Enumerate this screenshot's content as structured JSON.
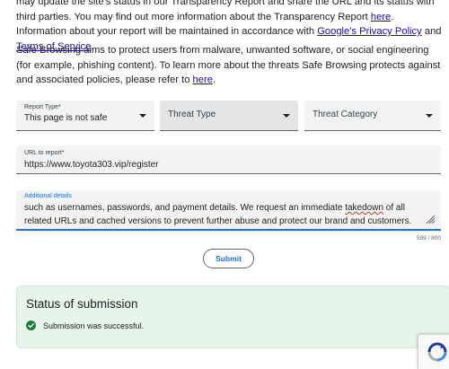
{
  "intro": {
    "p1_prefix": "may update the site's status in our Transparency Report and share the URL and its status with third parties. You may find out more information about the Transparency Report ",
    "p1_link1": "here",
    "p1_mid": ". Information about your report will be maintained in accordance with ",
    "p1_link2": "Google's Privacy Policy",
    "p1_and": " and ",
    "p1_link3": "Terms of Service",
    "p1_end": ".",
    "p2_prefix": "Safe Browsing aims to protect users from malware, unwanted software, or social engineering (for example, phishing content). To learn more about the threats Safe Browsing protects against and associated policies, please refer to ",
    "p2_link": "here",
    "p2_end": "."
  },
  "form": {
    "report_type": {
      "label": "Report Type*",
      "value": "This page is not safe"
    },
    "threat_type": {
      "placeholder": "Threat Type"
    },
    "threat_category": {
      "placeholder": "Threat Category"
    },
    "url": {
      "label": "URL to report*",
      "value": "https://www.toyota303.vip/register"
    },
    "details": {
      "label": "Additional details",
      "text_before": "such as usernames, passwords, and payment details. We request an immediate ",
      "text_misspelled": "takedown",
      "text_after": " of all related URLs and cached versions to prevent further abuse and protect our brand and customers."
    },
    "counter": "599 / 800",
    "submit_label": "Submit"
  },
  "status": {
    "title": "Status of submission",
    "message": "Submission was successful.",
    "icon": "check-circle-icon",
    "color": "#188038"
  },
  "recaptcha": {
    "icon": "recaptcha-icon"
  },
  "colors": {
    "accent": "#1a73e8",
    "link": "#1a0dab",
    "success_bg": "#e6f4ea"
  }
}
